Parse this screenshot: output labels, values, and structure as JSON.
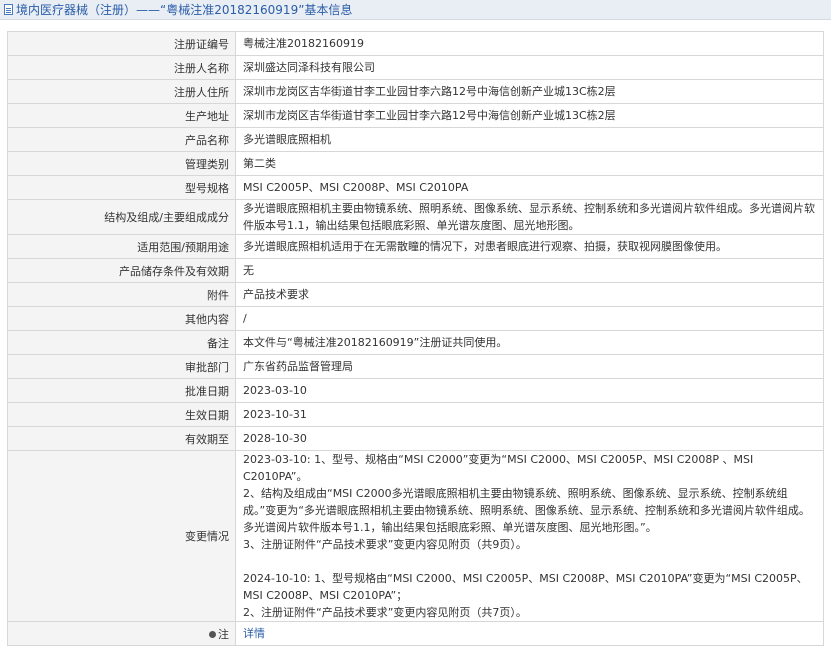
{
  "header": {
    "title": "境内医疗器械（注册）——“粤械注准20182160919”基本信息",
    "icon": "document-icon"
  },
  "rows": [
    {
      "label": "注册证编号",
      "value": "粤械注准20182160919"
    },
    {
      "label": "注册人名称",
      "value": "深圳盛达同泽科技有限公司"
    },
    {
      "label": "注册人住所",
      "value": "深圳市龙岗区吉华街道甘李工业园甘李六路12号中海信创新产业城13C栋2层"
    },
    {
      "label": "生产地址",
      "value": "深圳市龙岗区吉华街道甘李工业园甘李六路12号中海信创新产业城13C栋2层"
    },
    {
      "label": "产品名称",
      "value": "多光谱眼底照相机"
    },
    {
      "label": "管理类别",
      "value": "第二类"
    },
    {
      "label": "型号规格",
      "value": "MSI C2005P、MSI C2008P、MSI C2010PA"
    },
    {
      "label": "结构及组成/主要组成成分",
      "value": "多光谱眼底照相机主要由物镜系统、照明系统、图像系统、显示系统、控制系统和多光谱阅片软件组成。多光谱阅片软件版本号1.1，输出结果包括眼底彩照、单光谱灰度图、屈光地形图。"
    },
    {
      "label": "适用范围/预期用途",
      "value": "多光谱眼底照相机适用于在无需散瞳的情况下，对患者眼底进行观察、拍摄，获取视网膜图像使用。"
    },
    {
      "label": "产品储存条件及有效期",
      "value": "无"
    },
    {
      "label": "附件",
      "value": "产品技术要求"
    },
    {
      "label": "其他内容",
      "value": "/"
    },
    {
      "label": "备注",
      "value": "本文件与“粤械注准20182160919”注册证共同使用。"
    },
    {
      "label": "审批部门",
      "value": "广东省药品监督管理局"
    },
    {
      "label": "批准日期",
      "value": "2023-03-10"
    },
    {
      "label": "生效日期",
      "value": "2023-10-31"
    },
    {
      "label": "有效期至",
      "value": "2028-10-30"
    }
  ],
  "changes": {
    "label": "变更情况",
    "paragraphs": [
      "2023-03-10: 1、型号、规格由“MSI C2000”变更为“MSI C2000、MSI C2005P、MSI C2008P 、MSI C2010PA”。",
      "2、结构及组成由“MSI C2000多光谱眼底照相机主要由物镜系统、照明系统、图像系统、显示系统、控制系统组成。”变更为“多光谱眼底照相机主要由物镜系统、照明系统、图像系统、显示系统、控制系统和多光谱阅片软件组成。多光谱阅片软件版本号1.1，输出结果包括眼底彩照、单光谱灰度图、屈光地形图。”。",
      "3、注册证附件“产品技术要求”变更内容见附页（共9页）。",
      "",
      "2024-10-10: 1、型号规格由“MSI C2000、MSI C2005P、MSI C2008P、MSI C2010PA”变更为“MSI C2005P、MSI C2008P、MSI C2010PA”；",
      "2、注册证附件“产品技术要求”变更内容见附页（共7页）。"
    ]
  },
  "note": {
    "label": "注",
    "icon": "note-icon",
    "link": "详情"
  }
}
